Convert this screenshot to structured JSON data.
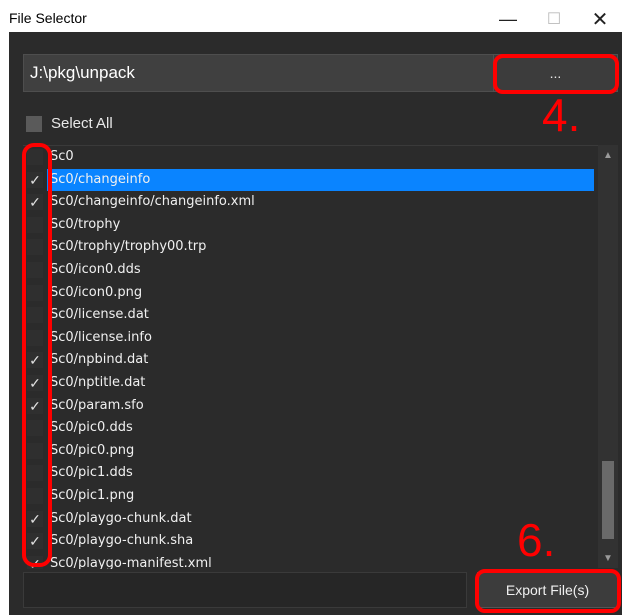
{
  "window": {
    "title": "File Selector",
    "min_glyph": "—",
    "max_glyph": "☐",
    "close_glyph": "✕"
  },
  "path_input": {
    "value": "J:\\pkg\\unpack"
  },
  "browse_button": {
    "label": "..."
  },
  "select_all": {
    "label": "Select All",
    "checked": false
  },
  "files": [
    {
      "name": "Sc0",
      "checked": false,
      "selected": false
    },
    {
      "name": "Sc0/changeinfo",
      "checked": true,
      "selected": true
    },
    {
      "name": "Sc0/changeinfo/changeinfo.xml",
      "checked": true,
      "selected": false
    },
    {
      "name": "Sc0/trophy",
      "checked": false,
      "selected": false
    },
    {
      "name": "Sc0/trophy/trophy00.trp",
      "checked": false,
      "selected": false
    },
    {
      "name": "Sc0/icon0.dds",
      "checked": false,
      "selected": false
    },
    {
      "name": "Sc0/icon0.png",
      "checked": false,
      "selected": false
    },
    {
      "name": "Sc0/license.dat",
      "checked": false,
      "selected": false
    },
    {
      "name": "Sc0/license.info",
      "checked": false,
      "selected": false
    },
    {
      "name": "Sc0/npbind.dat",
      "checked": true,
      "selected": false
    },
    {
      "name": "Sc0/nptitle.dat",
      "checked": true,
      "selected": false
    },
    {
      "name": "Sc0/param.sfo",
      "checked": true,
      "selected": false
    },
    {
      "name": "Sc0/pic0.dds",
      "checked": false,
      "selected": false
    },
    {
      "name": "Sc0/pic0.png",
      "checked": false,
      "selected": false
    },
    {
      "name": "Sc0/pic1.dds",
      "checked": false,
      "selected": false
    },
    {
      "name": "Sc0/pic1.png",
      "checked": false,
      "selected": false
    },
    {
      "name": "Sc0/playgo-chunk.dat",
      "checked": true,
      "selected": false
    },
    {
      "name": "Sc0/playgo-chunk.sha",
      "checked": true,
      "selected": false
    },
    {
      "name": "Sc0/playgo-manifest.xml",
      "checked": true,
      "selected": false
    }
  ],
  "export_button": {
    "label": "Export File(s)"
  },
  "annotations": {
    "step4": "4.",
    "step6": "6."
  },
  "colors": {
    "background": "#2b2b2b",
    "selection": "#0a84ff",
    "annotation": "#ff0000"
  }
}
